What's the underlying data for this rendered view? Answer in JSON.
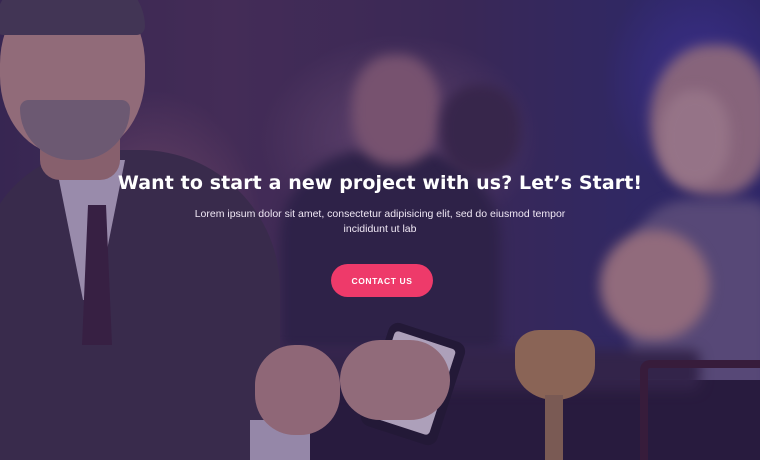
{
  "hero": {
    "headline": "Want to start a new project with us? Let’s Start!",
    "subtext": "Lorem ipsum dolor sit amet, consectetur adipisicing elit, sed do eiusmod tempor incididunt ut lab",
    "cta_label": "CONTACT US"
  },
  "colors": {
    "overlay": "#341c5a",
    "button": "#ee3a6a",
    "text": "#ffffff"
  },
  "background_image": "photo of people at a bar table, man holding smartphone"
}
